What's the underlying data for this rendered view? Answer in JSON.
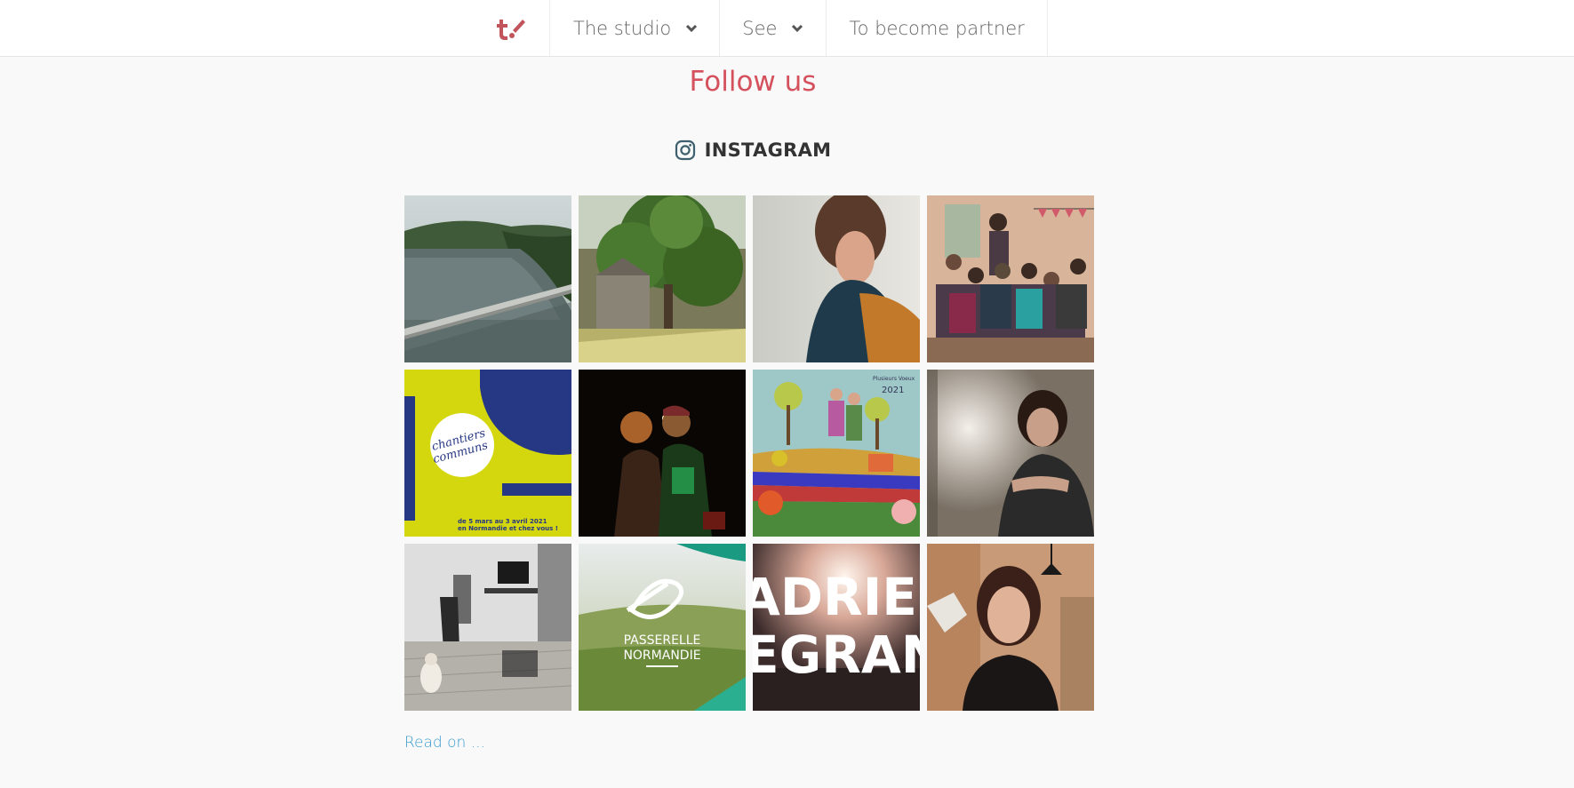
{
  "nav": {
    "logo": "t",
    "items": [
      {
        "label": "The studio",
        "has_dropdown": true
      },
      {
        "label": "See",
        "has_dropdown": true
      },
      {
        "label": "To become partner",
        "has_dropdown": false
      }
    ]
  },
  "section": {
    "title": "Follow us",
    "instagram_label": "INSTAGRAM",
    "read_on": "Read on ..."
  },
  "posts": [
    {
      "id": "lake-bridge"
    },
    {
      "id": "tree-house"
    },
    {
      "id": "woman-profile"
    },
    {
      "id": "group-photo"
    },
    {
      "id": "chantiers-communs",
      "text1": "chantiers",
      "text2": "communs",
      "caption1": "de 5 mars au 3 avril 2021",
      "caption2": "en Normandie et chez vous !"
    },
    {
      "id": "night-portrait"
    },
    {
      "id": "plusieurs-voeux",
      "text1": "Plusieurs Voeux",
      "text2": "2021"
    },
    {
      "id": "woman-hands"
    },
    {
      "id": "office-child"
    },
    {
      "id": "passerelle-normandie",
      "text1": "PASSERELLE",
      "text2": "NORMANDIE"
    },
    {
      "id": "adrien-legrand",
      "text1": "ADRIEN",
      "text2": "EGRAN"
    },
    {
      "id": "woman-speaking"
    }
  ],
  "colors": {
    "accent": "#d4515d",
    "link": "#3a9bcf",
    "nav_text": "#666666",
    "background": "#f9f9f9"
  }
}
